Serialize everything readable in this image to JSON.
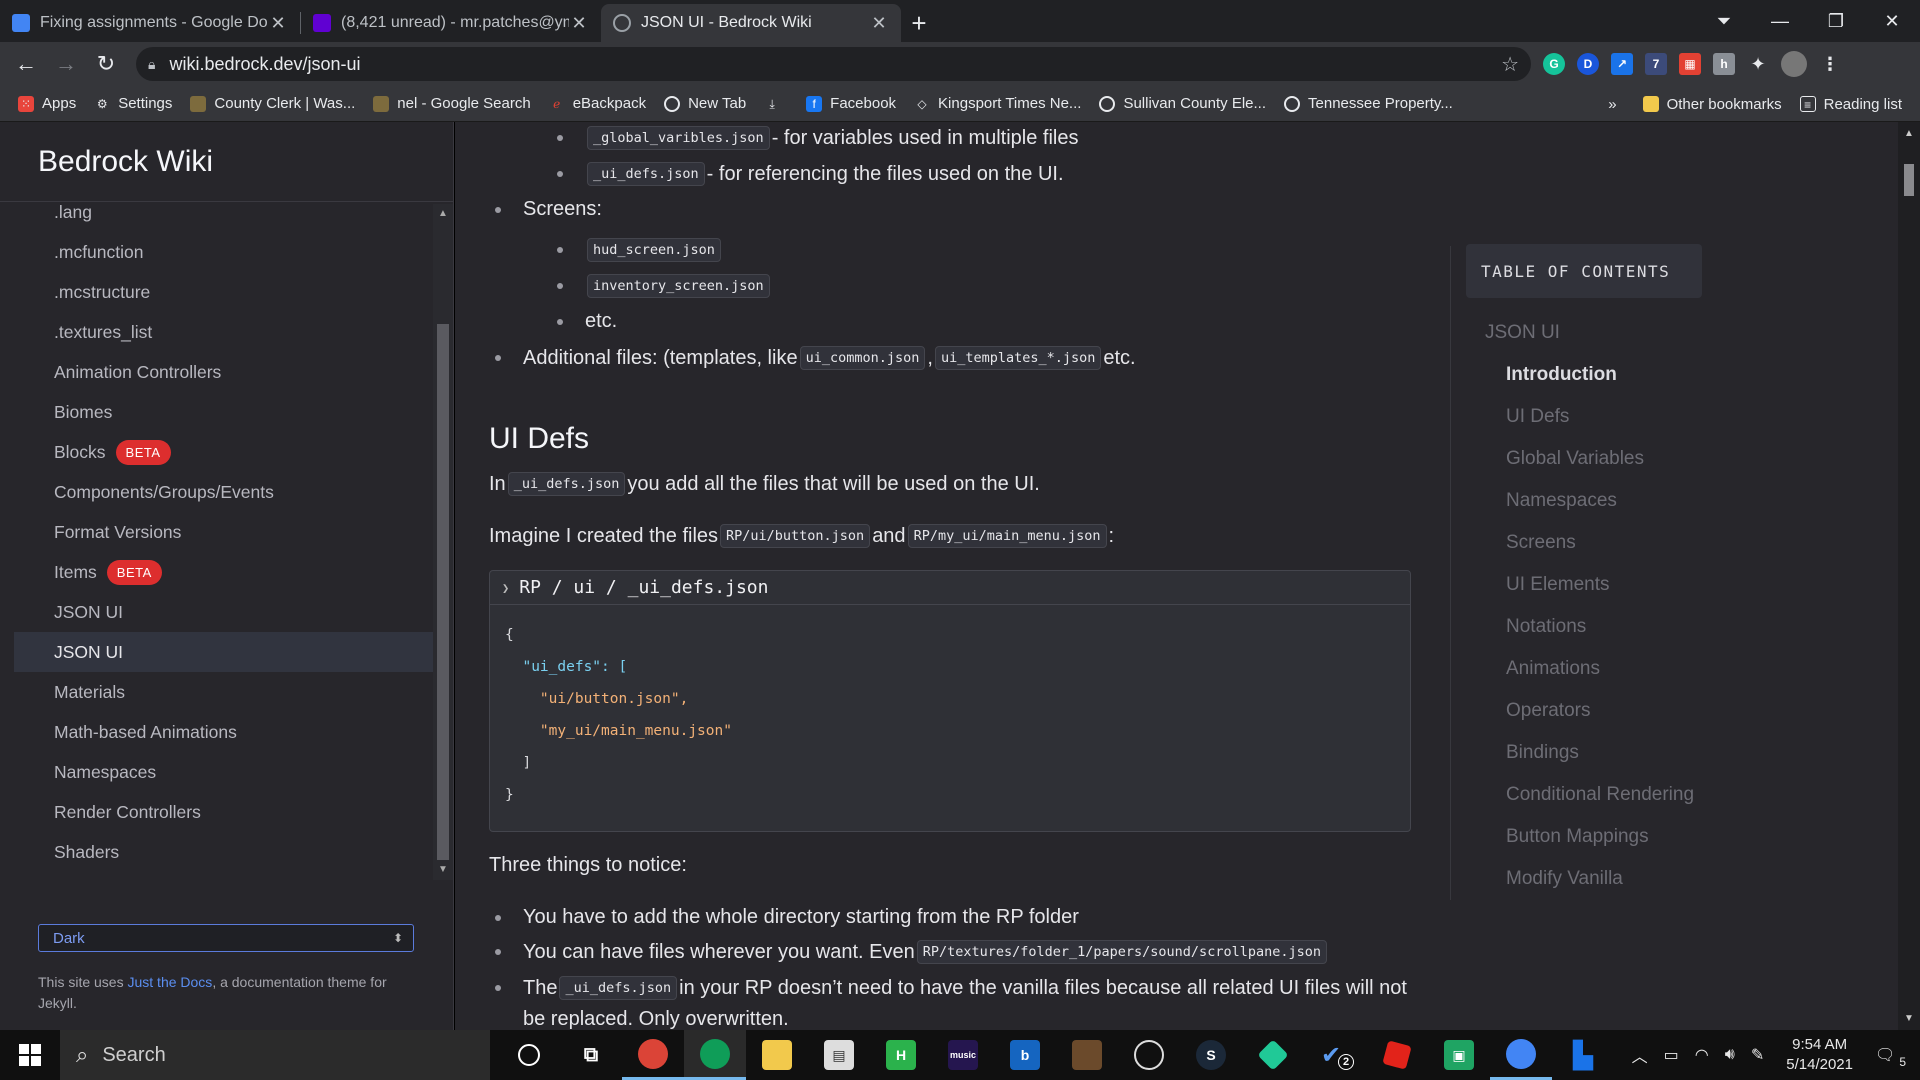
{
  "browser": {
    "tabs": [
      {
        "title": "Fixing assignments - Google Doc",
        "icon": "google-docs-icon",
        "color": "#4285f4"
      },
      {
        "title": "(8,421 unread) - mr.patches@ym",
        "icon": "yahoo-mail-icon",
        "color": "#6001d2"
      },
      {
        "title": "JSON UI - Bedrock Wiki",
        "icon": "globe-icon",
        "color": "#5f6368"
      }
    ],
    "url": "wiki.bedrock.dev/json-ui",
    "bookmarks": [
      {
        "label": "Apps",
        "icon": "apps-grid-icon"
      },
      {
        "label": "Settings",
        "icon": "gear-icon"
      },
      {
        "label": "County Clerk | Was...",
        "icon": "site-favicon-icon"
      },
      {
        "label": "nel - Google Search",
        "icon": "site-favicon-icon"
      },
      {
        "label": "eBackpack",
        "icon": "ebackpack-icon"
      },
      {
        "label": "New Tab",
        "icon": "globe-icon"
      },
      {
        "label": "",
        "icon": "download-icon"
      },
      {
        "label": "Facebook",
        "icon": "facebook-icon"
      },
      {
        "label": "Kingsport Times Ne...",
        "icon": "diamond-icon"
      },
      {
        "label": "Sullivan County Ele...",
        "icon": "globe-icon"
      },
      {
        "label": "Tennessee Property...",
        "icon": "globe-icon"
      }
    ],
    "bookmarks_more": "»",
    "other_bookmarks": "Other bookmarks",
    "reading_list": "Reading list"
  },
  "sidebar": {
    "brand": "Bedrock Wiki",
    "items": [
      {
        "label": ".lang",
        "badge": ""
      },
      {
        "label": ".mcfunction",
        "badge": ""
      },
      {
        "label": ".mcstructure",
        "badge": ""
      },
      {
        "label": ".textures_list",
        "badge": ""
      },
      {
        "label": "Animation Controllers",
        "badge": ""
      },
      {
        "label": "Biomes",
        "badge": ""
      },
      {
        "label": "Blocks",
        "badge": "BETA"
      },
      {
        "label": "Components/Groups/Events",
        "badge": ""
      },
      {
        "label": "Format Versions",
        "badge": ""
      },
      {
        "label": "Items",
        "badge": "BETA"
      },
      {
        "label": "JSON UI",
        "badge": ""
      },
      {
        "label": "JSON UI",
        "badge": "",
        "active": true
      },
      {
        "label": "Materials",
        "badge": ""
      },
      {
        "label": "Math-based Animations",
        "badge": ""
      },
      {
        "label": "Namespaces",
        "badge": ""
      },
      {
        "label": "Render Controllers",
        "badge": ""
      },
      {
        "label": "Shaders",
        "badge": ""
      }
    ],
    "theme_value": "Dark",
    "footer_pre": "This site uses ",
    "footer_link": "Just the Docs",
    "footer_post": ", a documentation theme for Jekyll."
  },
  "content": {
    "list1": [
      {
        "code": "_global_varibles.json",
        "text": " - for variables used in multiple files"
      },
      {
        "code": "_ui_defs.json",
        "text": " - for referencing the files used on the UI."
      }
    ],
    "screens_label": "Screens:",
    "screens": [
      "hud_screen.json",
      "inventory_screen.json"
    ],
    "etc": "etc.",
    "additional_pre": "Additional files: (templates, like ",
    "additional_code1": "ui_common.json",
    "additional_sep": ",",
    "additional_code2": "ui_templates_*.json",
    "additional_post": " etc.",
    "heading": "UI Defs",
    "p1_pre": "In ",
    "p1_code": "_ui_defs.json",
    "p1_post": " you add all the files that will be used on the UI.",
    "p2_pre": "Imagine I created the files ",
    "p2_code1": "RP/ui/button.json",
    "p2_mid": " and ",
    "p2_code2": "RP/my_ui/main_menu.json",
    "p2_post": ":",
    "code_title": "RP / ui / _ui_defs.json",
    "code_lines": [
      "{",
      "  \"ui_defs\": [",
      "    \"ui/button.json\",",
      "    \"my_ui/main_menu.json\"",
      "  ]",
      "}"
    ],
    "notice": "Three things to notice:",
    "b1": "You have to add the whole directory starting from the RP folder",
    "b2_pre": "You can have files wherever you want. Even ",
    "b2_code": "RP/textures/folder_1/papers/sound/scrollpane.json",
    "b3_pre": "The ",
    "b3_code": "_ui_defs.json",
    "b3_post": " in your RP doesn’t need to have the vanilla files because all related UI files will not",
    "b3_line2": "be replaced. Only overwritten."
  },
  "toc": {
    "heading": "TABLE OF CONTENTS",
    "root": "JSON UI",
    "items": [
      "Introduction",
      "UI Defs",
      "Global Variables",
      "Namespaces",
      "Screens",
      "UI Elements",
      "Notations",
      "Animations",
      "Operators",
      "Bindings",
      "Conditional Rendering",
      "Button Mappings",
      "Modify Vanilla"
    ]
  },
  "taskbar": {
    "search_placeholder": "Search",
    "time": "9:54 AM",
    "date": "5/14/2021",
    "notification_count": "5",
    "todo_badge": "2"
  }
}
